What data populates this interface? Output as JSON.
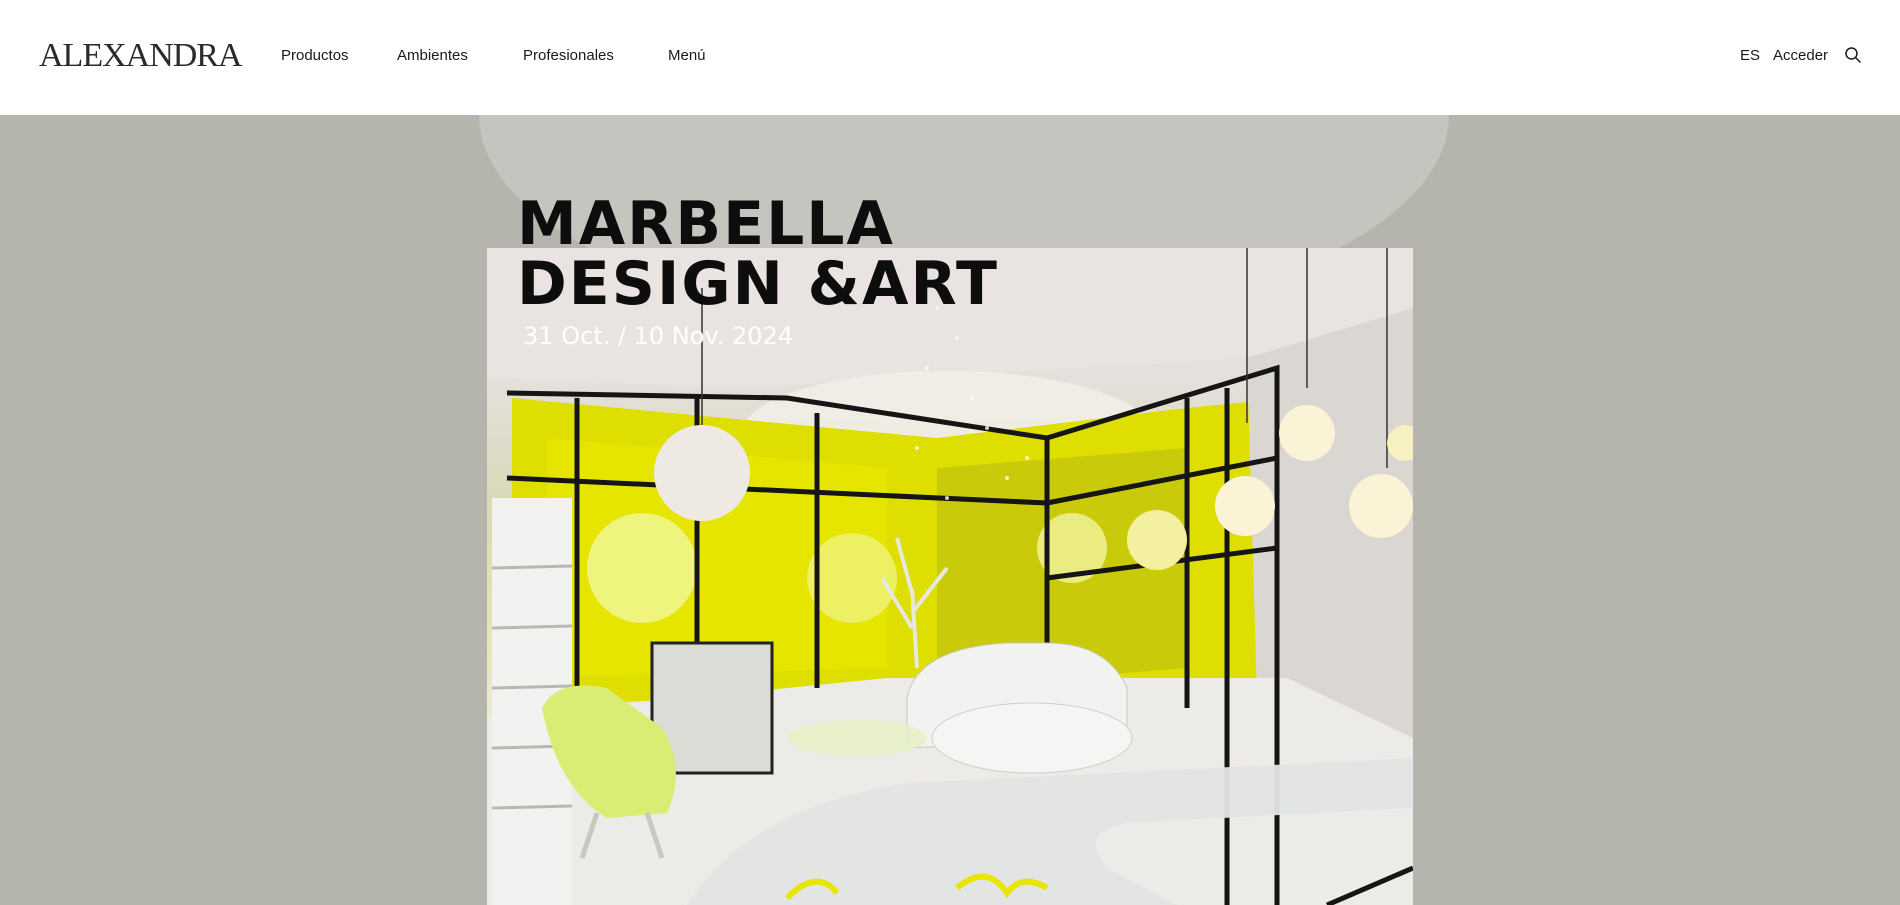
{
  "brand": {
    "logo": "ALEXANDRA"
  },
  "nav": {
    "items": [
      "Productos",
      "Ambientes",
      "Profesionales",
      "Menú"
    ]
  },
  "header_right": {
    "language": "ES",
    "login": "Acceder"
  },
  "hero": {
    "title": "MARBELLA\nDESIGN &ART",
    "date": "31 Oct. / 10 Nov. 2024"
  },
  "colors": {
    "background": "#b5b5ad",
    "header": "#ffffff",
    "accent_yellow": "#e8e600",
    "text": "#1a1a1a"
  },
  "icons": {
    "search": "search-icon"
  }
}
